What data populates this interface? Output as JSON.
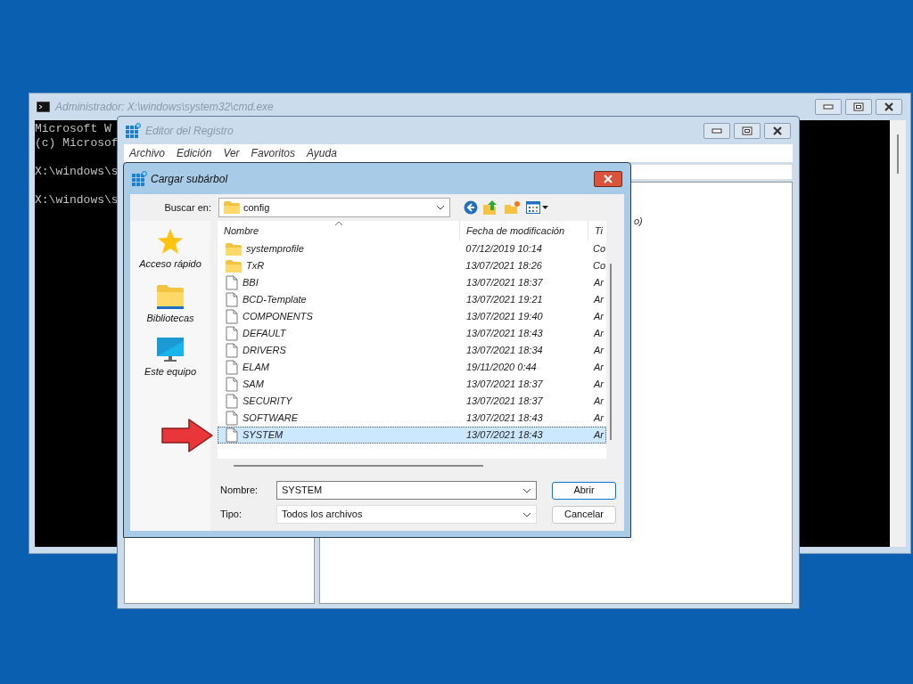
{
  "cmd_window": {
    "title": "Administrador: X:\\windows\\system32\\cmd.exe",
    "console_lines": [
      {
        "text": "Microsoft W",
        "blank_line_before": false
      },
      {
        "text": "(c) Microsof",
        "blank_line_before": false
      },
      {
        "text": "X:\\windows\\s",
        "blank_line_before": true
      },
      {
        "text": "X:\\windows\\s",
        "blank_line_before": true
      }
    ]
  },
  "regedit_window": {
    "title": "Editor del Registro",
    "menu": [
      "Archivo",
      "Edición",
      "Ver",
      "Favoritos",
      "Ayuda"
    ],
    "value_text": "o)"
  },
  "dialog": {
    "title": "Cargar subárbol",
    "look_in": {
      "label": "Buscar en:",
      "value": "config"
    },
    "places": [
      {
        "label": "Acceso rápido",
        "kind": "star"
      },
      {
        "label": "Bibliotecas",
        "kind": "library"
      },
      {
        "label": "Este equipo",
        "kind": "computer"
      }
    ],
    "file_list": {
      "columns": [
        "Nombre",
        "Fecha de modificación",
        "Ti"
      ],
      "rows": [
        {
          "name": "systemprofile",
          "date": "07/12/2019 10:14",
          "type": "Co",
          "kind": "folder",
          "selected": false
        },
        {
          "name": "TxR",
          "date": "13/07/2021 18:26",
          "type": "Co",
          "kind": "folder",
          "selected": false
        },
        {
          "name": "BBI",
          "date": "13/07/2021 18:37",
          "type": "Ar",
          "kind": "file",
          "selected": false
        },
        {
          "name": "BCD-Template",
          "date": "13/07/2021 19:21",
          "type": "Ar",
          "kind": "file",
          "selected": false
        },
        {
          "name": "COMPONENTS",
          "date": "13/07/2021 19:40",
          "type": "Ar",
          "kind": "file",
          "selected": false
        },
        {
          "name": "DEFAULT",
          "date": "13/07/2021 18:43",
          "type": "Ar",
          "kind": "file",
          "selected": false
        },
        {
          "name": "DRIVERS",
          "date": "13/07/2021 18:34",
          "type": "Ar",
          "kind": "file",
          "selected": false
        },
        {
          "name": "ELAM",
          "date": "19/11/2020 0:44",
          "type": "Ar",
          "kind": "file",
          "selected": false
        },
        {
          "name": "SAM",
          "date": "13/07/2021 18:37",
          "type": "Ar",
          "kind": "file",
          "selected": false
        },
        {
          "name": "SECURITY",
          "date": "13/07/2021 18:37",
          "type": "Ar",
          "kind": "file",
          "selected": false
        },
        {
          "name": "SOFTWARE",
          "date": "13/07/2021 18:43",
          "type": "Ar",
          "kind": "file",
          "selected": false
        },
        {
          "name": "SYSTEM",
          "date": "13/07/2021 18:43",
          "type": "Ar",
          "kind": "file",
          "selected": true
        }
      ]
    },
    "name_field": {
      "label": "Nombre:",
      "value": "SYSTEM"
    },
    "type_field": {
      "label": "Tipo:",
      "value": "Todos los archivos"
    },
    "buttons": [
      {
        "label": "Abrir",
        "default": true
      },
      {
        "label": "Cancelar",
        "default": false
      }
    ]
  }
}
